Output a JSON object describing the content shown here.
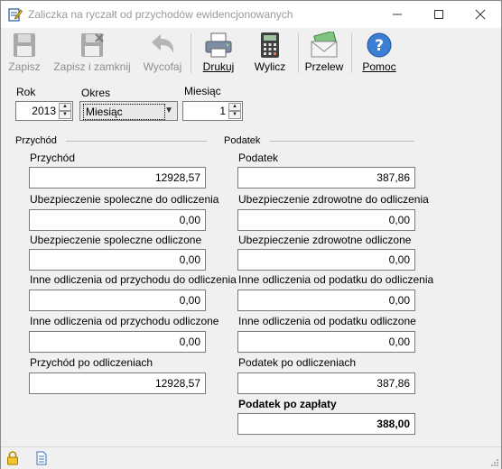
{
  "window": {
    "title": "Zaliczka na ryczałt od przychodów ewidencjonowanych",
    "controls": {
      "minimize": "—",
      "maximize": "☐",
      "close": "✕"
    }
  },
  "toolbar": {
    "save": "Zapisz",
    "save_close": "Zapisz i zamknij",
    "undo": "Wycofaj",
    "print": "Drukuj",
    "calculate": "Wylicz",
    "transfer": "Przelew",
    "help": "Pomoc"
  },
  "filters": {
    "year_label": "Rok",
    "year_value": "2013",
    "period_label": "Okres",
    "period_value": "Miesiąc",
    "month_label": "Miesiąc",
    "month_value": "1"
  },
  "przychod_section": {
    "title": "Przychód",
    "fields": [
      {
        "label": "Przychód",
        "value": "12928,57"
      },
      {
        "label": "Ubezpieczenie spoleczne do odliczenia",
        "value": "0,00"
      },
      {
        "label": "Ubezpieczenie spoleczne odliczone",
        "value": "0,00"
      },
      {
        "label": "Inne odliczenia od przychodu do odliczenia",
        "value": "0,00"
      },
      {
        "label": "Inne odliczenia od przychodu odliczone",
        "value": "0,00"
      },
      {
        "label": "Przychód po odliczeniach",
        "value": "12928,57"
      }
    ]
  },
  "podatek_section": {
    "title": "Podatek",
    "fields": [
      {
        "label": "Podatek",
        "value": "387,86"
      },
      {
        "label": "Ubezpieczenie zdrowotne do odliczenia",
        "value": "0,00"
      },
      {
        "label": "Ubezpieczenie zdrowotne odliczone",
        "value": "0,00"
      },
      {
        "label": "Inne odliczenia od podatku do odliczenia",
        "value": "0,00"
      },
      {
        "label": "Inne odliczenia od podatku odliczone",
        "value": "0,00"
      },
      {
        "label": "Podatek po odliczeniach",
        "value": "387,86"
      },
      {
        "label": "Podatek po zapłaty",
        "value": "388,00"
      }
    ]
  },
  "icons": {
    "app": "notepad-pencil-icon",
    "save": "floppy-disk-icon",
    "save_close": "floppy-disk-x-icon",
    "undo": "undo-arrow-icon",
    "print": "printer-icon",
    "calculate": "calculator-icon",
    "transfer": "envelope-money-icon",
    "help": "question-circle-icon",
    "status_lock": "padlock-icon",
    "status_doc": "document-icon"
  }
}
